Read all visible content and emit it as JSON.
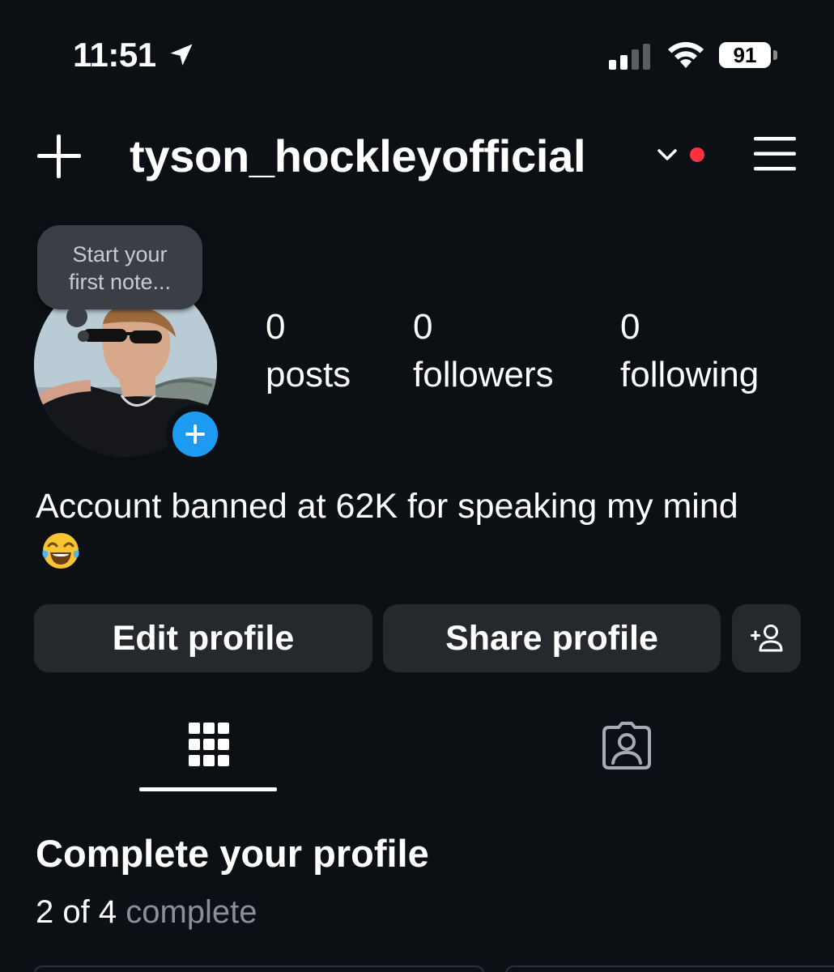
{
  "status_bar": {
    "time": "11:51",
    "battery": "91",
    "icons": [
      "location-arrow-icon",
      "cellular-signal-icon",
      "wifi-icon",
      "battery-icon"
    ]
  },
  "header": {
    "username": "tyson_hockleyofficial",
    "icons": [
      "plus-icon",
      "chevron-down-icon",
      "notification-dot",
      "hamburger-menu-icon"
    ],
    "notification_color": "#ff3040"
  },
  "profile": {
    "note_line1": "Start your",
    "note_line2": "first note...",
    "stats": {
      "posts": {
        "value": "0",
        "label": "posts"
      },
      "followers": {
        "value": "0",
        "label": "followers"
      },
      "following": {
        "value": "0",
        "label": "following"
      }
    },
    "bio_text": "Account banned at 62K for speaking my mind",
    "bio_emoji": "face-with-tears-of-joy"
  },
  "actions": {
    "edit_label": "Edit profile",
    "share_label": "Share profile",
    "add_user_icon": "add-person-icon"
  },
  "tabs": {
    "items": [
      "grid-icon",
      "tagged-person-icon"
    ],
    "active": "grid-icon"
  },
  "complete_profile": {
    "title": "Complete your profile",
    "count": "2 of 4",
    "suffix": "complete",
    "completed": 2,
    "total": 4
  },
  "colors": {
    "background": "#0c1014",
    "button": "#25292e",
    "accent_blue": "#1d9bf0",
    "muted_text": "#8b9097"
  }
}
